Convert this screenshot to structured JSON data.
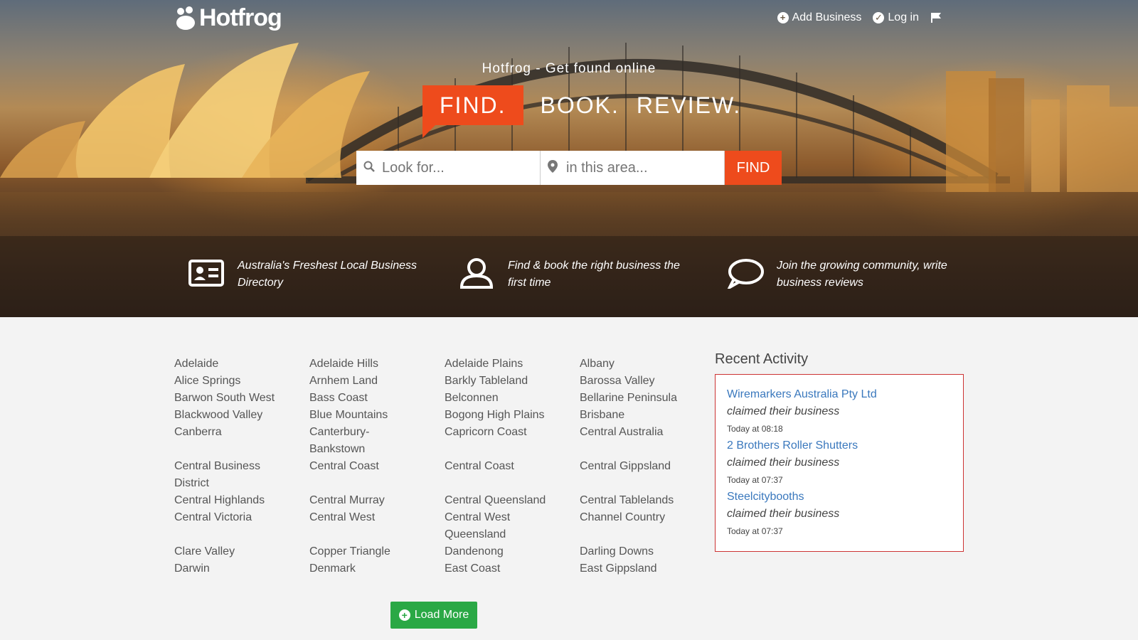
{
  "brand": {
    "logo_text": "Hotfrog"
  },
  "nav": {
    "add_business": "Add Business",
    "log_in": "Log in"
  },
  "hero": {
    "tagline": "Hotfrog - Get found online",
    "find": "FIND.",
    "book": "BOOK.",
    "review": "REVIEW."
  },
  "search": {
    "what_placeholder": "Look for...",
    "where_placeholder": "in this area...",
    "button": "FIND"
  },
  "features": [
    {
      "icon": "id-card-icon",
      "text": "Australia's Freshest Local Business Directory"
    },
    {
      "icon": "user-icon",
      "text": "Find & book the right business the first time"
    },
    {
      "icon": "speech-bubble-icon",
      "text": "Join the growing community, write business reviews"
    }
  ],
  "regions": [
    [
      "Adelaide",
      "Adelaide Hills",
      "Adelaide Plains",
      "Albany"
    ],
    [
      "Alice Springs",
      "Arnhem Land",
      "Barkly Tableland",
      "Barossa Valley"
    ],
    [
      "Barwon South West",
      "Bass Coast",
      "Belconnen",
      "Bellarine Peninsula"
    ],
    [
      "Blackwood Valley",
      "Blue Mountains",
      "Bogong High Plains",
      "Brisbane"
    ],
    [
      "Canberra",
      "Canterbury-Bankstown",
      "Capricorn Coast",
      "Central Australia"
    ],
    [
      "Central Business District",
      "Central Coast",
      "Central Coast",
      "Central Gippsland"
    ],
    [
      "Central Highlands",
      "Central Murray",
      "Central Queensland",
      "Central Tablelands"
    ],
    [
      "Central Victoria",
      "Central West",
      "Central West Queensland",
      "Channel Country"
    ],
    [
      "Clare Valley",
      "Copper Triangle",
      "Dandenong",
      "Darling Downs"
    ],
    [
      "Darwin",
      "Denmark",
      "East Coast",
      "East Gippsland"
    ]
  ],
  "load_more": "Load More",
  "recent": {
    "title": "Recent Activity",
    "items": [
      {
        "business": "Wiremarkers Australia Pty Ltd",
        "action": "claimed their business",
        "time": "Today at 08:18"
      },
      {
        "business": "2 Brothers Roller Shutters",
        "action": "claimed their business",
        "time": "Today at 07:37"
      },
      {
        "business": "Steelcitybooths",
        "action": "claimed their business",
        "time": "Today at 07:37"
      }
    ]
  },
  "colors": {
    "accent": "#ee4b1c",
    "load_more": "#2aa845",
    "link": "#3a78bd",
    "recent_border": "#cc3333"
  }
}
